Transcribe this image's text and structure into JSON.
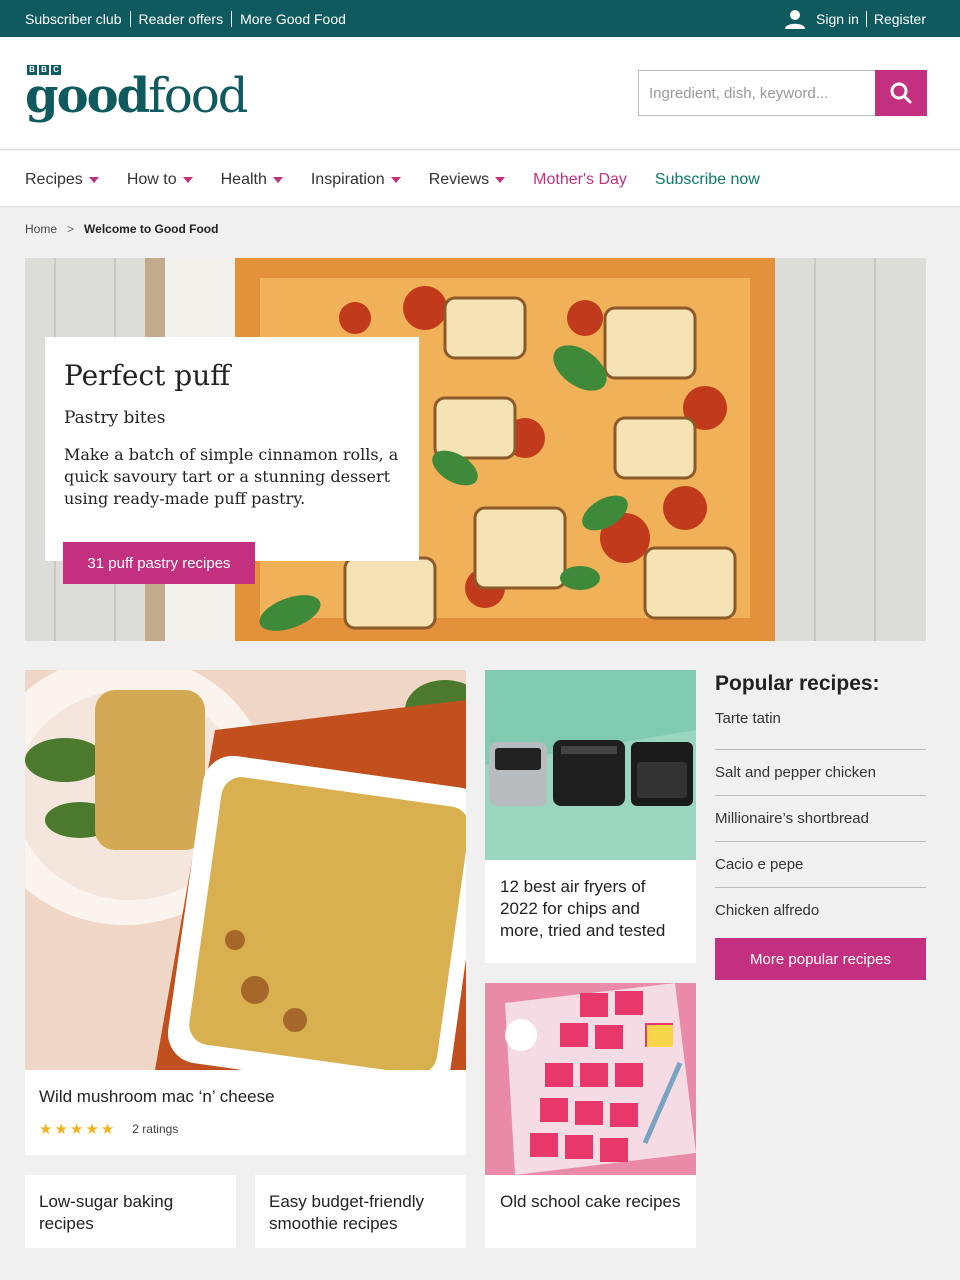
{
  "topbar": {
    "links": [
      "Subscriber club",
      "Reader offers",
      "More Good Food"
    ],
    "sign_in": "Sign in",
    "register": "Register"
  },
  "logo": {
    "bbc": [
      "B",
      "B",
      "C"
    ],
    "good": "good",
    "food": "food"
  },
  "search": {
    "placeholder": "Ingredient, dish, keyword..."
  },
  "nav": {
    "items": [
      {
        "label": "Recipes"
      },
      {
        "label": "How to"
      },
      {
        "label": "Health"
      },
      {
        "label": "Inspiration"
      },
      {
        "label": "Reviews"
      }
    ],
    "mothers_day": "Mother's Day",
    "subscribe": "Subscribe now"
  },
  "breadcrumb": {
    "home": "Home",
    "current": "Welcome to Good Food"
  },
  "hero": {
    "title": "Perfect puff",
    "subtitle": "Pastry bites",
    "description": "Make a batch of simple cinnamon rolls, a quick savoury tart or a stunning dessert using ready-made puff pastry.",
    "button": "31 puff pastry recipes"
  },
  "cards": {
    "mac": {
      "title": "Wild mushroom mac ‘n’ cheese",
      "rating": 5,
      "ratings_text": "2 ratings"
    },
    "airfryers": {
      "title": "12 best air fryers of 2022 for chips and more, tried and tested"
    },
    "cake": {
      "title": "Old school cake recipes"
    },
    "lowsugar": {
      "title": "Low-sugar baking recipes"
    },
    "smoothie": {
      "title": "Easy budget-friendly smoothie recipes"
    }
  },
  "popular": {
    "heading": "Popular recipes:",
    "items": [
      "Tarte tatin",
      "Salt and pepper chicken",
      "Millionaire’s shortbread",
      "Cacio e pepe",
      "Chicken alfredo"
    ],
    "button": "More popular recipes"
  },
  "colors": {
    "teal": "#0e5a5f",
    "pink": "#c2307f",
    "star": "#f3b21a"
  }
}
